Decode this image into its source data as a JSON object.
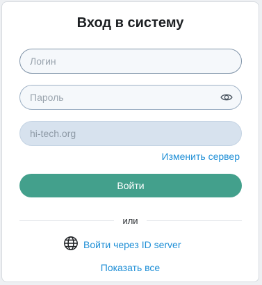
{
  "login_form": {
    "title": "Вход в систему",
    "login_placeholder": "Логин",
    "password_placeholder": "Пароль",
    "server_value": "hi-tech.org",
    "change_server_label": "Изменить сервер",
    "submit_label": "Войти",
    "or_label": "или",
    "id_server_label": "Войти через ID server",
    "show_all_label": "Показать все",
    "icons": {
      "password_toggle": "eye-icon",
      "id_server": "globe-icon"
    },
    "colors": {
      "accent": "#43a08c",
      "link": "#1f8fd6"
    }
  }
}
